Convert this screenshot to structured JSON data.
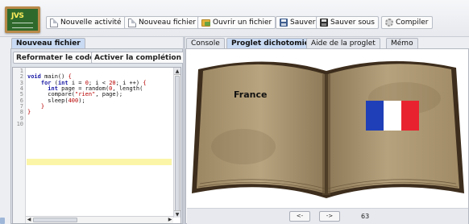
{
  "toolbar": {
    "logo_text": "JVS",
    "buttons": [
      {
        "label": "Nouvelle activité",
        "icon": "new-document-icon"
      },
      {
        "label": "Nouveau fichier",
        "icon": "new-file-icon"
      },
      {
        "label": "Ouvrir un fichier",
        "icon": "open-folder-icon"
      },
      {
        "label": "Sauver",
        "icon": "save-disk-icon"
      },
      {
        "label": "Sauver sous",
        "icon": "save-as-disk-icon"
      },
      {
        "label": "Compiler",
        "icon": "gear-icon"
      }
    ]
  },
  "left_panel": {
    "tab": "Nouveau fichier",
    "reformat_button": "Reformater le code",
    "completion_button": "Activer la complétion",
    "line_numbers": [
      "1",
      "2",
      "3",
      "4",
      "5",
      "6",
      "7",
      "8",
      "9",
      "10"
    ],
    "code_lines": [
      "",
      "void main() {",
      "    for (int i = 0; i < 20; i ++) {",
      "      int page = random(0, length(",
      "      compare(\"rien\", page);",
      "      sleep(400);",
      "    }",
      "}",
      "",
      ""
    ]
  },
  "right_panel": {
    "tabs": [
      "Console",
      "Proglet dichotomie",
      "Aide de la proglet",
      "Mémo"
    ],
    "active_tab": "Proglet dichotomie",
    "book_page_text": "France",
    "flag_colors": [
      "#1f3fb8",
      "#ffffff",
      "#e8232f"
    ],
    "prev_button": "<-",
    "next_button": "->",
    "page_number": "63"
  }
}
